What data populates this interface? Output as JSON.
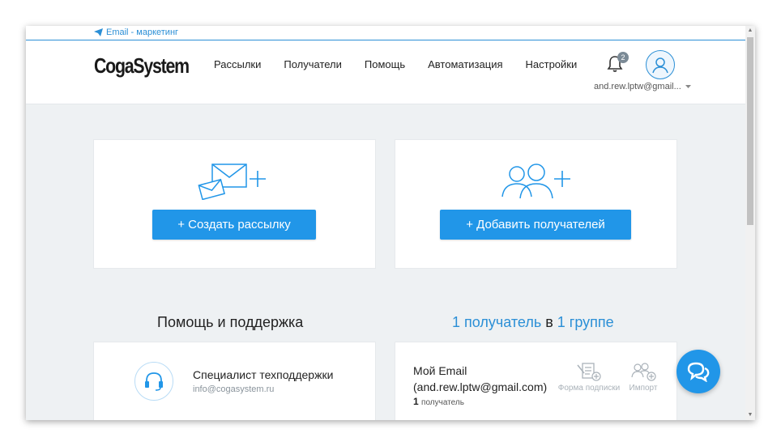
{
  "topbar": {
    "tab_label": "Email - маркетинг"
  },
  "header": {
    "logo": "CogaSystem",
    "nav": [
      "Рассылки",
      "Получатели",
      "Помощь",
      "Автоматизация",
      "Настройки"
    ],
    "notifications_count": "2",
    "user_email": "and.rew.lptw@gmail..."
  },
  "actions": {
    "create_campaign": "+ Создать рассылку",
    "add_recipients": "+ Добавить получателей"
  },
  "support": {
    "title": "Помощь и поддержка",
    "specialist": "Специалист техподдержки",
    "email": "info@cogasystem.ru"
  },
  "recipients_summary": {
    "count_link": "1 получатель",
    "in": " в ",
    "groups_link": "1 группе"
  },
  "list": {
    "name_line1": "Мой Email",
    "name_line2": "(and.rew.lptw@gmail.com)",
    "count": "1",
    "count_label": "получатель",
    "form_label": "Форма подписки",
    "import_label": "Импорт"
  },
  "colors": {
    "accent": "#2196e8",
    "link": "#2b8fd6",
    "background": "#eef1f3"
  }
}
